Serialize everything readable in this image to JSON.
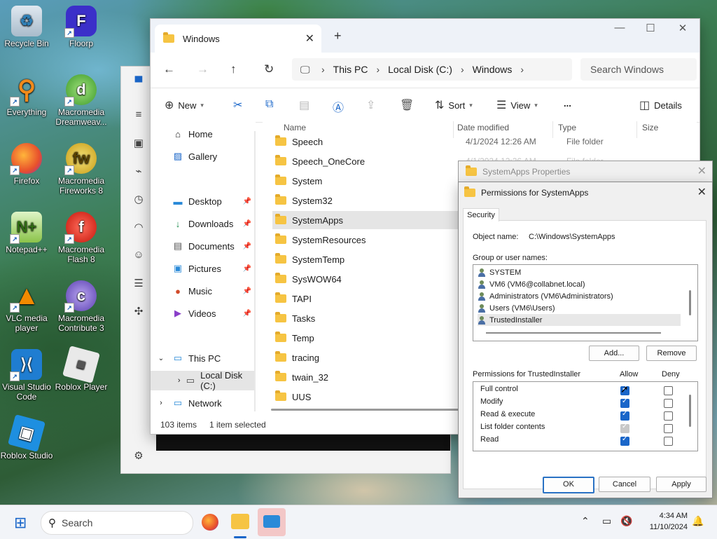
{
  "desktop": {
    "icons": [
      {
        "label": "Recycle Bin"
      },
      {
        "label": "Floorp"
      },
      {
        "label": "Everything"
      },
      {
        "label": "Macromedia Dreamweav..."
      },
      {
        "label": "Firefox"
      },
      {
        "label": "Macromedia Fireworks 8"
      },
      {
        "label": "Notepad++"
      },
      {
        "label": "Macromedia Flash 8"
      },
      {
        "label": "VLC media player"
      },
      {
        "label": "Macromedia Contribute 3"
      },
      {
        "label": "Visual Studio Code"
      },
      {
        "label": "Roblox Player"
      },
      {
        "label": "Roblox Studio"
      }
    ]
  },
  "explorer": {
    "tab_title": "Windows",
    "breadcrumb": [
      "This PC",
      "Local Disk (C:)",
      "Windows"
    ],
    "search_placeholder": "Search Windows",
    "toolbar": {
      "new": "New",
      "sort": "Sort",
      "view": "View",
      "more": "...",
      "details": "Details"
    },
    "nav": {
      "home": "Home",
      "gallery": "Gallery",
      "desktop": "Desktop",
      "downloads": "Downloads",
      "documents": "Documents",
      "pictures": "Pictures",
      "music": "Music",
      "videos": "Videos",
      "this_pc": "This PC",
      "local_disk": "Local Disk (C:)",
      "network": "Network"
    },
    "columns": {
      "name": "Name",
      "date": "Date modified",
      "type": "Type",
      "size": "Size"
    },
    "rows": [
      {
        "name": "Speech",
        "date": "4/1/2024 12:26 AM",
        "type": "File folder"
      },
      {
        "name": "Speech_OneCore",
        "date": "4/1/2024 12:26 AM",
        "type": "File folder"
      },
      {
        "name": "System"
      },
      {
        "name": "System32"
      },
      {
        "name": "SystemApps"
      },
      {
        "name": "SystemResources"
      },
      {
        "name": "SystemTemp"
      },
      {
        "name": "SysWOW64"
      },
      {
        "name": "TAPI"
      },
      {
        "name": "Tasks"
      },
      {
        "name": "Temp"
      },
      {
        "name": "tracing"
      },
      {
        "name": "twain_32"
      },
      {
        "name": "UUS"
      }
    ],
    "status": {
      "count": "103 items",
      "selected": "1 item selected"
    }
  },
  "properties": {
    "title": "SystemApps Properties"
  },
  "permissions": {
    "title": "Permissions for SystemApps",
    "tab": "Security",
    "object_label": "Object name:",
    "object_value": "C:\\Windows\\SystemApps",
    "group_label": "Group or user names:",
    "users": [
      "SYSTEM",
      "VM6 (VM6@collabnet.local)",
      "Administrators (VM6\\Administrators)",
      "Users (VM6\\Users)",
      "TrustedInstaller"
    ],
    "add_btn": "Add...",
    "remove_btn": "Remove",
    "perm_label": "Permissions for TrustedInstaller",
    "allow": "Allow",
    "deny": "Deny",
    "perms": [
      {
        "name": "Full control",
        "allow": "on",
        "deny": "off"
      },
      {
        "name": "Modify",
        "allow": "on",
        "deny": "off"
      },
      {
        "name": "Read & execute",
        "allow": "on",
        "deny": "off"
      },
      {
        "name": "List folder contents",
        "allow": "dim",
        "deny": "off"
      },
      {
        "name": "Read",
        "allow": "on",
        "deny": "off"
      }
    ],
    "ok": "OK",
    "cancel": "Cancel",
    "apply": "Apply"
  },
  "taskbar": {
    "search": "Search",
    "time": "4:34 AM",
    "date": "11/10/2024"
  }
}
